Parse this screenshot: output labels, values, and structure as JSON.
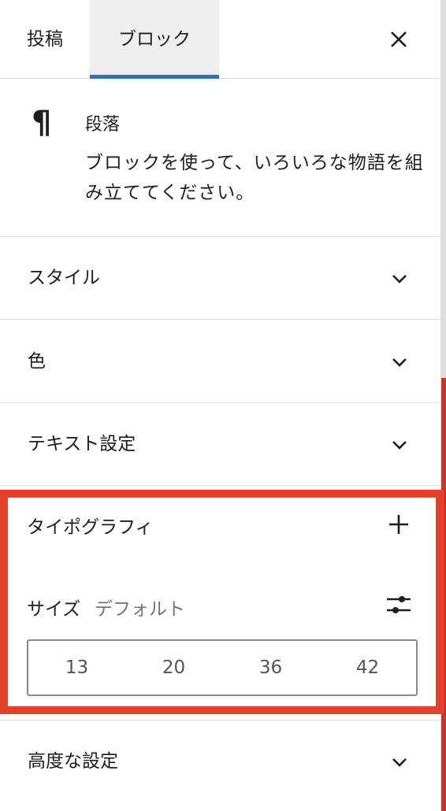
{
  "tabs": {
    "post": "投稿",
    "block": "ブロック"
  },
  "close_icon": "close-icon",
  "block_card": {
    "icon": "paragraph-icon",
    "icon_glyph": "¶",
    "title": "段落",
    "description": "ブロックを使って、いろいろな物語を組み立ててください。"
  },
  "panels": {
    "style": "スタイル",
    "color": "色",
    "text_settings": "テキスト設定",
    "advanced": "高度な設定"
  },
  "typography": {
    "title": "タイポグラフィ",
    "size_label": "サイズ",
    "size_value": "デフォルト",
    "size_options": [
      "13",
      "20",
      "36",
      "42"
    ]
  },
  "colors": {
    "accent": "#3071b8",
    "highlight": "#e5402a"
  }
}
